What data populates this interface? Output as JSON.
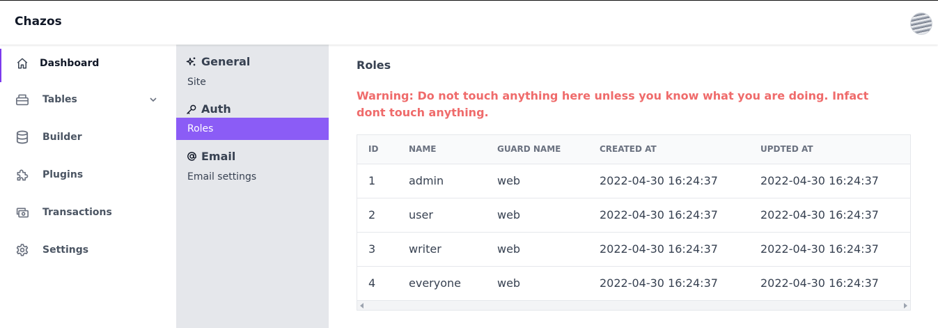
{
  "app": {
    "brand": "Chazos"
  },
  "sidebar": {
    "items": [
      {
        "label": "Dashboard",
        "icon": "home-icon",
        "active": true
      },
      {
        "label": "Tables",
        "icon": "tables-icon",
        "has_chevron": true
      },
      {
        "label": "Builder",
        "icon": "database-icon"
      },
      {
        "label": "Plugins",
        "icon": "puzzle-icon"
      },
      {
        "label": "Transactions",
        "icon": "cash-icon"
      },
      {
        "label": "Settings",
        "icon": "gear-icon"
      }
    ]
  },
  "subnav": {
    "sections": [
      {
        "title": "General",
        "icon": "sparkles-icon",
        "links": [
          "Site"
        ]
      },
      {
        "title": "Auth",
        "icon": "key-icon",
        "links": [
          "Roles"
        ]
      },
      {
        "title": "Email",
        "icon": "at-icon",
        "links": [
          "Email settings"
        ]
      }
    ],
    "active_link": "Roles"
  },
  "main": {
    "title": "Roles",
    "warning": "Warning: Do not touch anything here unless you know what you are doing. Infact dont touch anything.",
    "table": {
      "columns": [
        "ID",
        "NAME",
        "GUARD NAME",
        "CREATED AT",
        "UPDTED AT"
      ],
      "rows": [
        [
          "1",
          "admin",
          "web",
          "2022-04-30 16:24:37",
          "2022-04-30 16:24:37"
        ],
        [
          "2",
          "user",
          "web",
          "2022-04-30 16:24:37",
          "2022-04-30 16:24:37"
        ],
        [
          "3",
          "writer",
          "web",
          "2022-04-30 16:24:37",
          "2022-04-30 16:24:37"
        ],
        [
          "4",
          "everyone",
          "web",
          "2022-04-30 16:24:37",
          "2022-04-30 16:24:37"
        ]
      ]
    }
  },
  "colors": {
    "accent": "#8b5cf6",
    "warning": "#ef6b6b",
    "subpanel_bg": "#e5e7eb"
  }
}
